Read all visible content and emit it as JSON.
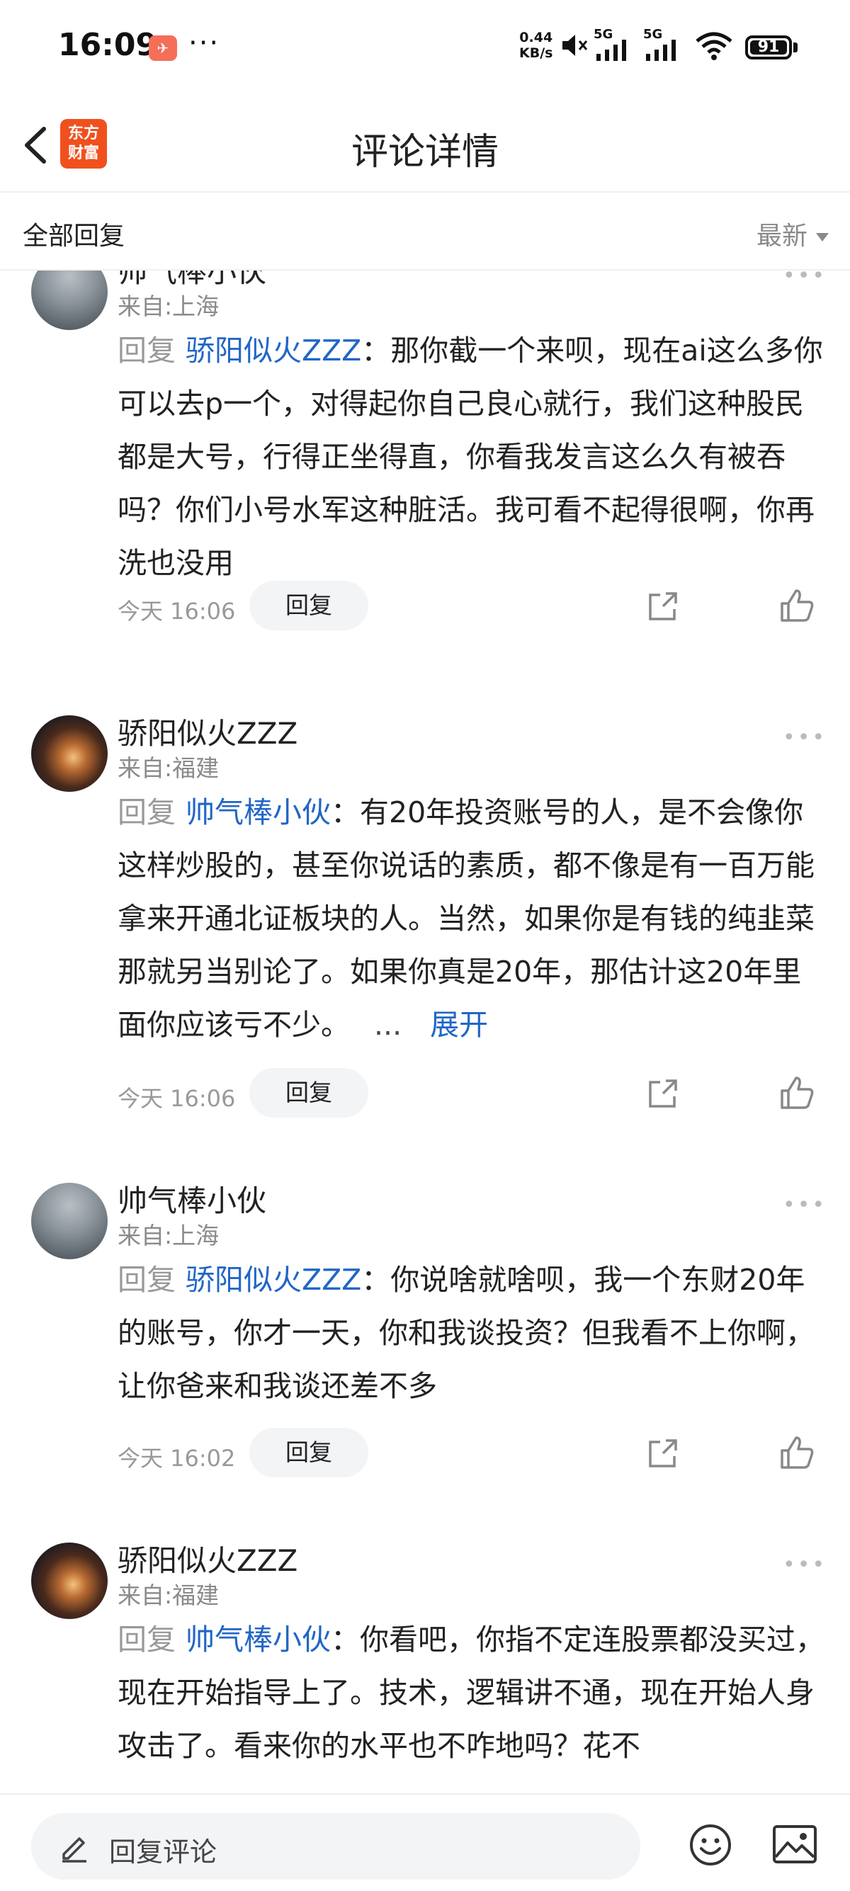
{
  "status_bar": {
    "time": "16:09",
    "app_icon": "message-app-icon",
    "more": "···",
    "net_speed_value": "0.44",
    "net_speed_unit": "KB/s",
    "signal_1": "5G",
    "signal_2": "5G",
    "battery": "91"
  },
  "nav": {
    "logo_line1": "东方",
    "logo_line2": "财富",
    "title": "评论详情"
  },
  "filter": {
    "left": "全部回复",
    "right": "最新"
  },
  "comments": [
    {
      "name": "帅气棒小伙",
      "location": "来自:上海",
      "prefix": "回复",
      "mention": "骄阳似火ZZZ",
      "text": "：那你截一个来呗，现在ai这么多你可以去p一个，对得起你自己良心就行，我们这种股民都是大号，行得正坐得直，你看我发言这么久有被吞吗？你们小号水军这种脏活。我可看不起得很啊，你再洗也没用",
      "time": "今天 16:06",
      "reply": "回复"
    },
    {
      "name": "骄阳似火ZZZ",
      "location": "来自:福建",
      "prefix": "回复",
      "mention": "帅气棒小伙",
      "text": "：有20年投资账号的人，是不会像你这样炒股的，甚至你说话的素质，都不像是有一百万能拿来开通北证板块的人。当然，如果你是有钱的纯韭菜那就另当别论了。如果你真是20年，那估计这20年里面你应该亏不少。",
      "ellipsis": "...",
      "expand": "展开",
      "time": "今天 16:06",
      "reply": "回复"
    },
    {
      "name": "帅气棒小伙",
      "location": "来自:上海",
      "prefix": "回复",
      "mention": "骄阳似火ZZZ",
      "text": "：你说啥就啥呗，我一个东财20年的账号，你才一天，你和我谈投资？但我看不上你啊，让你爸来和我谈还差不多",
      "time": "今天 16:02",
      "reply": "回复"
    },
    {
      "name": "骄阳似火ZZZ",
      "location": "来自:福建",
      "prefix": "回复",
      "mention": "帅气棒小伙",
      "text": "：你看吧，你指不定连股票都没买过，现在开始指导上了。技术，逻辑讲不通，现在开始人身攻击了。看来你的水平也不咋地吗？花不",
      "time": "",
      "reply": ""
    }
  ],
  "bottom": {
    "placeholder": "回复评论"
  }
}
